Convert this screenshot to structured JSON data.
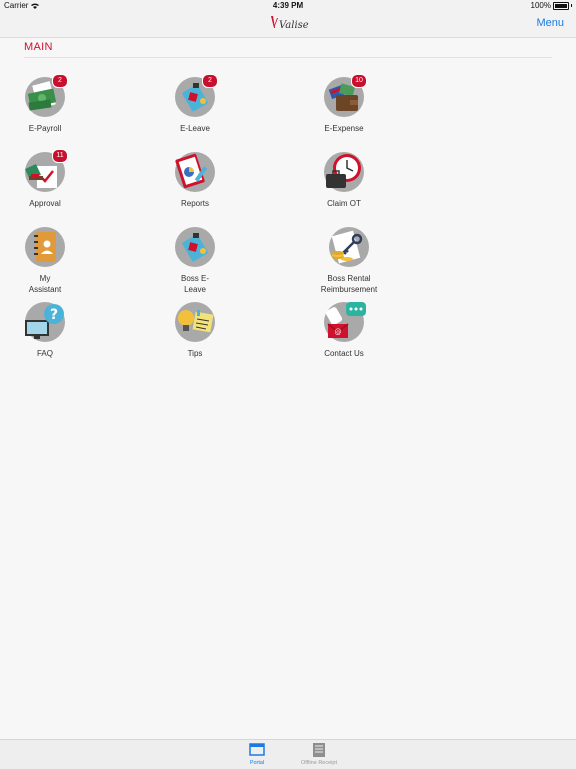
{
  "status": {
    "carrier": "Carrier",
    "time": "4:39 PM",
    "battery": "100%"
  },
  "nav": {
    "logo": "Valise",
    "menu": "Menu"
  },
  "section": {
    "title": "MAIN"
  },
  "tiles": [
    {
      "label": "E-Payroll",
      "badge": "2"
    },
    {
      "label": "E-Leave",
      "badge": "2"
    },
    {
      "label": "E-Expense",
      "badge": "10"
    },
    {
      "label": "Approval",
      "badge": "11"
    },
    {
      "label": "Reports"
    },
    {
      "label": "Claim OT"
    },
    {
      "label": "My Assistant"
    },
    {
      "label": "Boss E-Leave"
    },
    {
      "label": "Boss Rental Reimbursement"
    },
    {
      "label": "FAQ"
    },
    {
      "label": "Tips"
    },
    {
      "label": "Contact Us"
    }
  ],
  "tabs": [
    {
      "label": "Portal",
      "active": true
    },
    {
      "label": "Offline Receipt",
      "active": false
    }
  ],
  "colors": {
    "accent": "#1a7be5",
    "brand_red": "#d0112b",
    "badge": "#c8102e"
  }
}
